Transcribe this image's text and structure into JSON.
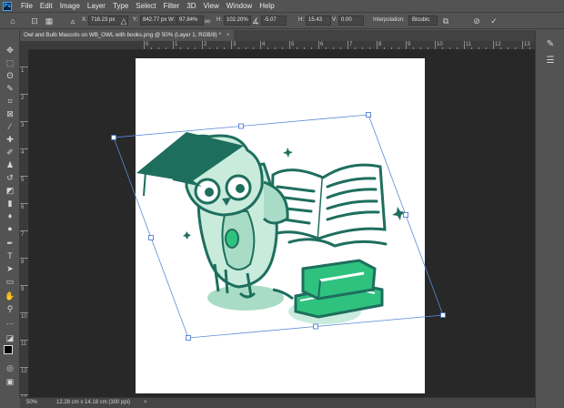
{
  "menubar": {
    "logo": "Ps",
    "items": [
      "File",
      "Edit",
      "Image",
      "Layer",
      "Type",
      "Select",
      "Filter",
      "3D",
      "View",
      "Window",
      "Help"
    ]
  },
  "options": {
    "x_label": "X:",
    "x_value": "718.23 px",
    "y_label": "Y:",
    "y_value": "842.77 px",
    "w_label": "W:",
    "w_value": "97.84%",
    "h_label": "H:",
    "h_value": "102.20%",
    "angle_value": "-5.07",
    "h_skew_label": "H:",
    "h_skew_value": "15.43",
    "v_skew_label": "V:",
    "v_skew_value": "0.00",
    "interpolation_label": "Interpolation:",
    "interpolation_value": "Bicubic"
  },
  "document": {
    "tab_title": "Owl and Bulb Mascots on WB_OWL with books.png @ 50% (Layer 1, RGB/8) *",
    "close_glyph": "×"
  },
  "ruler": {
    "h_labels": [
      "0",
      "1",
      "2",
      "3",
      "4",
      "5",
      "6",
      "7",
      "8",
      "9",
      "10",
      "11",
      "12",
      "13",
      "14",
      "15",
      "16"
    ],
    "v_labels": [
      "1",
      "2",
      "3",
      "4",
      "5",
      "6",
      "7",
      "8",
      "9",
      "10",
      "11",
      "12",
      "13"
    ]
  },
  "status": {
    "zoom": "50%",
    "doc_size": "12.28 cm x 14.18 cm (300 ppi)",
    "arrow": ">"
  },
  "colors": {
    "ui_bg": "#535353",
    "pasteboard": "#282828",
    "teal_dark": "#1e6e5e",
    "teal_light": "#a9dcc6",
    "green": "#2ec27e",
    "transform_box": "#5b8bd6"
  }
}
